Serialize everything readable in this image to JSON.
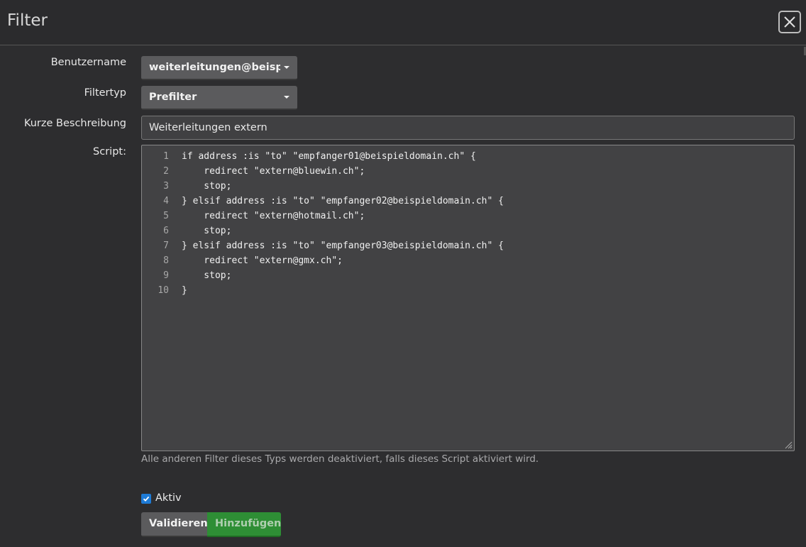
{
  "dialog": {
    "title": "Filter",
    "close_icon": "close-icon"
  },
  "form": {
    "username": {
      "label": "Benutzername",
      "value": "weiterleitungen@beispieldomain.ch"
    },
    "filter_type": {
      "label": "Filtertyp",
      "value": "Prefilter"
    },
    "description": {
      "label": "Kurze Beschreibung",
      "value": "Weiterleitungen extern"
    },
    "script": {
      "label": "Script:",
      "lines": [
        {
          "no": "1",
          "code": "if address :is \"to\" \"empfanger01@beispieldomain.ch\" {"
        },
        {
          "no": "2",
          "code": "    redirect \"extern@bluewin.ch\";"
        },
        {
          "no": "3",
          "code": "    stop;"
        },
        {
          "no": "4",
          "code": "} elsif address :is \"to\" \"empfanger02@beispieldomain.ch\" {"
        },
        {
          "no": "5",
          "code": "    redirect \"extern@hotmail.ch\";"
        },
        {
          "no": "6",
          "code": "    stop;"
        },
        {
          "no": "7",
          "code": "} elsif address :is \"to\" \"empfanger03@beispieldomain.ch\" {"
        },
        {
          "no": "8",
          "code": "    redirect \"extern@gmx.ch\";"
        },
        {
          "no": "9",
          "code": "    stop;"
        },
        {
          "no": "10",
          "code": "}"
        }
      ],
      "help": "Alle anderen Filter dieses Typs werden deaktiviert, falls dieses Script aktiviert wird."
    },
    "active": {
      "label": "Aktiv",
      "checked": true
    }
  },
  "buttons": {
    "validate": "Validieren",
    "add": "Hinzufügen"
  },
  "colors": {
    "background": "#2d2d2f",
    "checkbox_accent": "#1e7bd6",
    "add_button": "#2e8e35"
  }
}
